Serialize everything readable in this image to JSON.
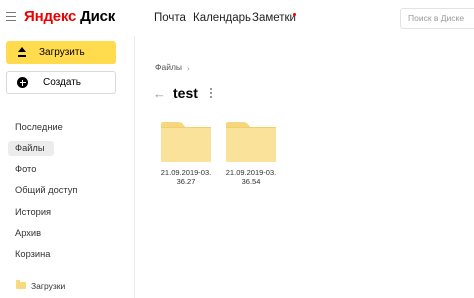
{
  "header": {
    "logo_ya": "Яндекс",
    "logo_disk": "Диск",
    "nav": [
      "Почта",
      "Календарь",
      "Заметки"
    ],
    "search_placeholder": "Поиск в Диске"
  },
  "sidebar": {
    "upload_label": "Загрузить",
    "create_label": "Создать",
    "items": [
      "Последние",
      "Файлы",
      "Фото",
      "Общий доступ",
      "История",
      "Архив",
      "Корзина"
    ],
    "active_item": "Файлы",
    "folder_item": "Загрузки"
  },
  "main": {
    "breadcrumb": "Файлы",
    "title": "test",
    "folders": [
      {
        "line1": "21.09.2019-03.",
        "line2": "36.27"
      },
      {
        "line1": "21.09.2019-03.",
        "line2": "36.54"
      }
    ]
  },
  "colors": {
    "accent_yellow": "#ffdb4d",
    "logo_red": "#ee0000",
    "folder": "#fbe29a"
  }
}
